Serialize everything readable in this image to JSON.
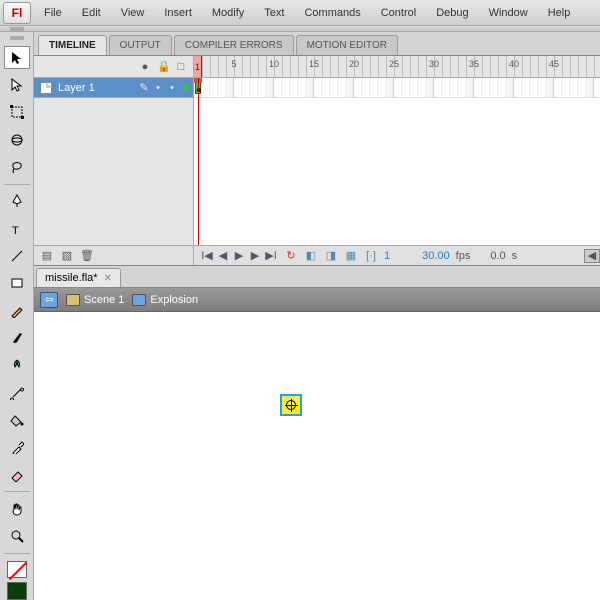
{
  "app": {
    "logo_letter": "Fl"
  },
  "menu": [
    "File",
    "Edit",
    "View",
    "Insert",
    "Modify",
    "Text",
    "Commands",
    "Control",
    "Debug",
    "Window",
    "Help"
  ],
  "panel_tabs": [
    "TIMELINE",
    "OUTPUT",
    "COMPILER ERRORS",
    "MOTION EDITOR"
  ],
  "timeline": {
    "header_icons": {
      "eye": "●",
      "lock": "🔒",
      "outline": "□"
    },
    "ruler_numbers": [
      1,
      5,
      10,
      15,
      20,
      25,
      30,
      35,
      40,
      45
    ],
    "layers": [
      {
        "name": "Layer 1"
      }
    ],
    "footer": {
      "frame": "1",
      "fps": "30.00",
      "fps_unit": "fps",
      "elapsed": "0.0",
      "elapsed_unit": "s"
    }
  },
  "document": {
    "tab_name": "missile.fla*"
  },
  "breadcrumb": {
    "scene": "Scene 1",
    "symbol": "Explosion"
  },
  "swatches": {
    "stroke": "#000000",
    "stroke_none_slash": "#ff0000",
    "fill": "#0a3d0a"
  }
}
